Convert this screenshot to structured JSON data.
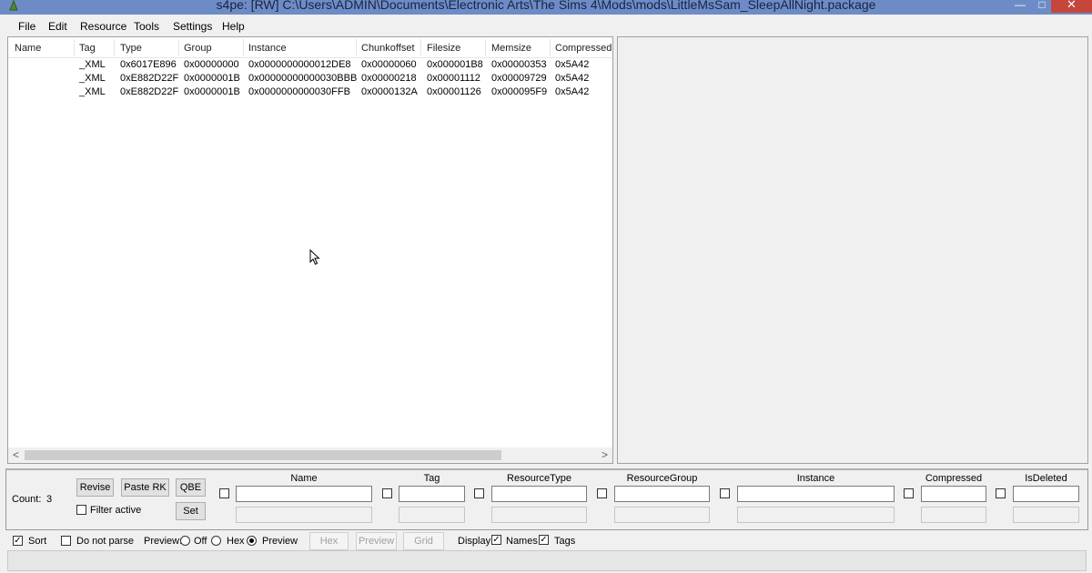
{
  "window": {
    "title": "s4pe: [RW] C:\\Users\\ADMIN\\Documents\\Electronic Arts\\The Sims 4\\Mods\\mods\\LittleMsSam_SleepAllNight.package",
    "min_glyph": "—",
    "max_glyph": "□",
    "close_glyph": "✕"
  },
  "menu": [
    "File",
    "Edit",
    "Resource",
    "Tools",
    "Settings",
    "Help"
  ],
  "list": {
    "columns": [
      "Name",
      "Tag",
      "Type",
      "Group",
      "Instance",
      "Chunkoffset",
      "Filesize",
      "Memsize",
      "Compressed"
    ],
    "rows": [
      [
        "",
        "_XML",
        "0x6017E896",
        "0x00000000",
        "0x0000000000012DE8",
        "0x00000060",
        "0x000001B8",
        "0x00000353",
        "0x5A42"
      ],
      [
        "",
        "_XML",
        "0xE882D22F",
        "0x0000001B",
        "0x00000000000030BBB",
        "0x00000218",
        "0x00001112",
        "0x00009729",
        "0x5A42"
      ],
      [
        "",
        "_XML",
        "0xE882D22F",
        "0x0000001B",
        "0x0000000000030FFB",
        "0x0000132A",
        "0x00001126",
        "0x000095F9",
        "0x5A42"
      ]
    ],
    "scroll_left": "<",
    "scroll_right": ">"
  },
  "filter": {
    "count_label": "Count:",
    "count_value": "3",
    "buttons": {
      "revise": "Revise",
      "paste_rk": "Paste RK",
      "qbe": "QBE",
      "set": "Set"
    },
    "filter_active_label": "Filter active",
    "filter_active_checked": false,
    "columns": [
      "Name",
      "Tag",
      "ResourceType",
      "ResourceGroup",
      "Instance",
      "Compressed",
      "IsDeleted"
    ]
  },
  "options": {
    "sort_label": "Sort",
    "sort_checked": true,
    "do_not_parse_label": "Do not parse",
    "do_not_parse_checked": false,
    "preview_label": "Preview:",
    "preview_options": [
      "Off",
      "Hex",
      "Preview"
    ],
    "preview_selected": "Preview",
    "buttons": {
      "hex": "Hex",
      "preview": "Preview",
      "grid": "Grid"
    },
    "display_label": "Display:",
    "names_label": "Names",
    "names_checked": true,
    "tags_label": "Tags",
    "tags_checked": true
  },
  "colors": {
    "titlebar": "#6d8cc7",
    "close": "#c7463c"
  }
}
